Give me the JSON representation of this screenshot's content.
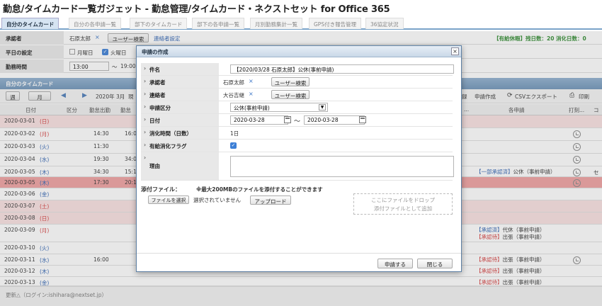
{
  "page": {
    "title": "勤怠/タイムカード一覧ガジェット - 勤怠管理/タイムカード・ネクストセット for Office 365"
  },
  "tabs": [
    "自分のタイムカード",
    "自分の各申請一覧",
    "部下のタイムカード",
    "部下の各申請一覧",
    "月別勤務集計一覧",
    "GPS付き報告管理",
    "36協定状況"
  ],
  "summary": {
    "text": "【有給休暇】残日数：20  消化日数：0"
  },
  "background": {
    "approver_label": "承認者",
    "approver_value": "石原太郎",
    "user_search_label": "ユーザー検索",
    "contact_setting_label": "連絡者設定",
    "weekday_label": "平日の設定",
    "weekday_mon": "月曜日",
    "weekday_tue": "火曜日",
    "hours_label": "勤務時間",
    "hours_start": "13:00",
    "hours_end": "19:00",
    "section_title": "自分のタイムカード",
    "week_label": "週",
    "month_label": "月",
    "period": "2020年 3月",
    "now_label": "現",
    "export_label": "申請作成",
    "csv_label": "CSVエクスポート",
    "print_label": "印刷",
    "print_fragment": "録",
    "col_date": "日付",
    "col_kind": "区分",
    "col_in": "勤怠出勤",
    "col_out": "勤怠",
    "col_each": "各申請",
    "col_stamp": "打刻...",
    "col_end": "コ",
    "ellipsis": "..."
  },
  "rows": [
    {
      "date": "2020-03-01",
      "dow": "日",
      "in": "",
      "out": "",
      "apps": [],
      "clock": false
    },
    {
      "date": "2020-03-02",
      "dow": "月",
      "in": "14:30",
      "out": "16:0",
      "apps": [],
      "clock": true
    },
    {
      "date": "2020-03-03",
      "dow": "火",
      "in": "11:30",
      "out": "",
      "apps": [],
      "clock": true
    },
    {
      "date": "2020-03-04",
      "dow": "水",
      "in": "19:30",
      "out": "34:0",
      "apps": [],
      "clock": true
    },
    {
      "date": "2020-03-05",
      "dow": "木",
      "in": "34:30",
      "out": "15:1",
      "apps": [
        {
          "status": "【一部承認済】",
          "text": "公休（事前申請）"
        }
      ],
      "clock": true,
      "extra": "セ"
    },
    {
      "date": "2020-03-05",
      "dow": "木",
      "in": "17:30",
      "out": "20:1",
      "apps": [],
      "clock": true
    },
    {
      "date": "2020-03-06",
      "dow": "金",
      "in": "",
      "out": "",
      "apps": [],
      "clock": false
    },
    {
      "date": "2020-03-07",
      "dow": "土",
      "in": "",
      "out": "",
      "apps": [],
      "clock": false
    },
    {
      "date": "2020-03-08",
      "dow": "日",
      "in": "",
      "out": "",
      "apps": [],
      "clock": false
    },
    {
      "date": "2020-03-09",
      "dow": "月",
      "in": "",
      "out": "",
      "apps": [
        {
          "status": "【承認済】",
          "text": "代休（事前申請）"
        },
        {
          "status": "【承認待】",
          "text": "出張（事前申請）"
        }
      ],
      "clock": false
    },
    {
      "date": "2020-03-10",
      "dow": "火",
      "in": "",
      "out": "",
      "apps": [],
      "clock": false
    },
    {
      "date": "2020-03-11",
      "dow": "水",
      "in": "16:00",
      "out": "",
      "apps": [
        {
          "status": "【承認待】",
          "text": "出張（事前申請）"
        }
      ],
      "clock": true
    },
    {
      "date": "2020-03-12",
      "dow": "木",
      "in": "",
      "out": "",
      "apps": [
        {
          "status": "【承認待】",
          "text": "出張（事前申請）"
        }
      ],
      "clock": false
    },
    {
      "date": "2020-03-13",
      "dow": "金",
      "in": "",
      "out": "",
      "apps": [
        {
          "status": "【承認待】",
          "text": "出張（事前申請）"
        }
      ],
      "clock": false
    }
  ],
  "footer": {
    "text": "更新△（ログイン:ishihara@nextset.jp）"
  },
  "dialog": {
    "title": "申請の作成",
    "close": "×",
    "subject_label": "件名",
    "subject_value": "【2020/03/28 石原太郎】公休(事前申請)",
    "approver_label": "承認者",
    "approver_value": "石原太郎",
    "contact_label": "連絡者",
    "contact_value": "大谷吉継",
    "user_search": "ユーザー検索",
    "remove_mark": "×",
    "category_label": "申請区分",
    "category_value": "公休(事前申請)",
    "date_label": "日付",
    "date_from": "2020-03-28",
    "date_tilde": "～",
    "date_to": "2020-03-28",
    "consumption_label": "消化時間（日数）",
    "consumption_value": "1日",
    "paid_flag_label": "有給消化フラグ",
    "reason_label": "理由",
    "attach_label": "添付ファイル：",
    "attach_note": "※最大200MBのファイルを添付することができます",
    "choose_file": "ファイルを選択",
    "no_file": "選択されていません",
    "upload": "アップロード",
    "drop_line1": "ここにファイルをドロップ",
    "drop_line2": "添付ファイルとして追加",
    "submit": "申請する",
    "close_button": "閉じる"
  },
  "colors": {
    "accent": "#6e93b8",
    "sunday_row": "#f9e1e1",
    "highlight_row": "#f0a0a0",
    "status_red": "#d43a3a",
    "status_blue": "#2a5fb0",
    "summary_green": "#2f8a2f"
  }
}
